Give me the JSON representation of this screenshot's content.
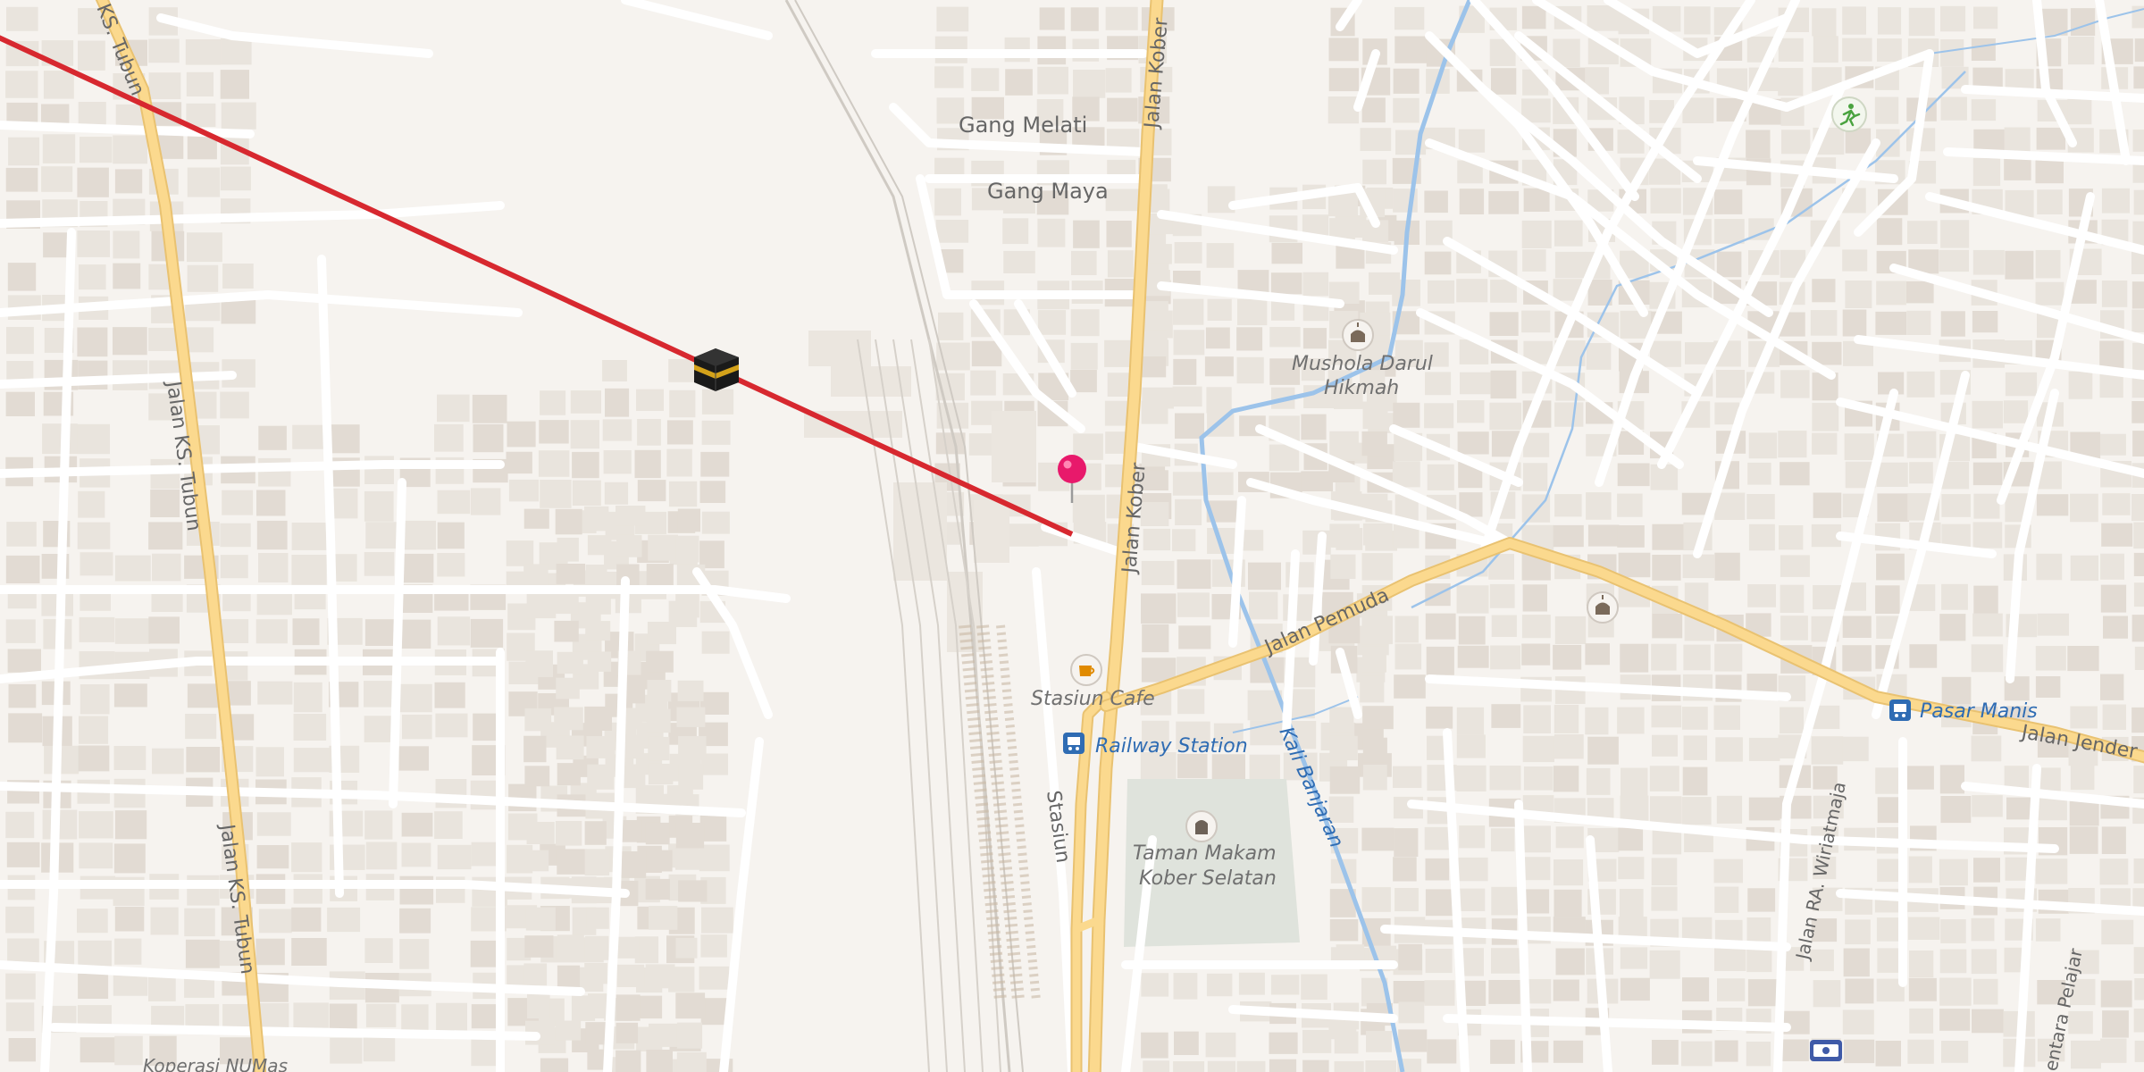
{
  "map": {
    "streets": {
      "jalan_kobe_north": "Jalan Kober",
      "jalan_kobe_south": "Jalan Kober",
      "jalan_pemuda": "Jalan Pemuda",
      "jalan_jendral": "Jalan Jender",
      "ks_tubun_top": "KS. Tubun",
      "ks_tubun_mid": "Jalan KS. Tubun",
      "ks_tubun_bottom": "Jalan KS. Tubun",
      "gang_melati": "Gang Melati",
      "gang_maya": "Gang Maya",
      "stasiun": "Stasiun",
      "ra_wiriatmaja": "Jalan RA. Wiriatmaja",
      "pentara_pelajar": "entara Pelajar",
      "kali_banjaran": "Kali Banjaran"
    },
    "pois": {
      "mushola": "Mushola Darul\nHikmah",
      "mushola_line1": "Mushola Darul",
      "mushola_line2": "Hikmah",
      "stasiun_cafe": "Stasiun Cafe",
      "railway_station": "Railway Station",
      "taman_makam_line1": "Taman Makam",
      "taman_makam_line2": "Kober Selatan",
      "pasar_manis": "Pasar Manis",
      "koperasi": "Koperasi NUMas"
    },
    "colors": {
      "background": "#f6f3ef",
      "building": "#e7e2db",
      "minor_road": "#ffffff",
      "major_road": "#fbd98e",
      "major_road_casing": "#e9c271",
      "river": "#9cc3ea",
      "qibla_line": "#d7282f",
      "pin": "#e8196b",
      "cemetery": "#dfe3dc",
      "transit": "#2f6cb3"
    },
    "icons": [
      "kaaba-icon",
      "map-pin-icon",
      "mosque-icon",
      "cafe-icon",
      "bus-icon",
      "cemetery-icon",
      "park-runner-icon",
      "atm-icon"
    ]
  }
}
